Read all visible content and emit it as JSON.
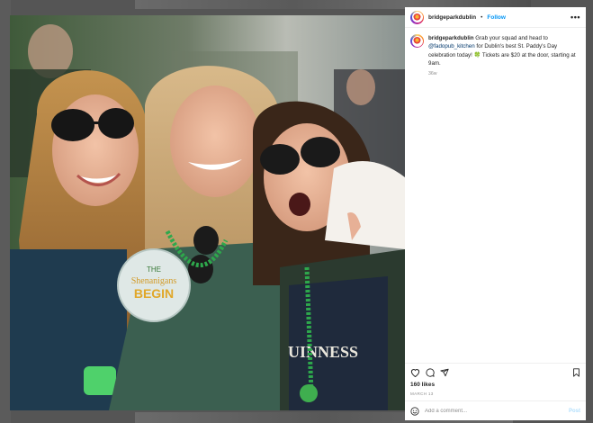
{
  "post": {
    "username": "bridgeparkdublin",
    "separator": "•",
    "follow_label": "Follow",
    "more_label": "•••",
    "caption_username": "bridgeparkdublin",
    "caption_text_1": " Grab your squad and head to ",
    "caption_mention": "@fadopub_kitchen",
    "caption_text_2": " for Dublin's best St. Paddy's Day celebration today! ",
    "caption_emoji": "🍀",
    "caption_text_3": " Tickets are $20 at the door, starting at 9am.",
    "time_ago": "36w",
    "likes": "160 likes",
    "date": "MARCH 13",
    "comment_placeholder": "Add a comment...",
    "post_label": "Post"
  },
  "photo": {
    "button_text_1": "THE",
    "button_text_2": "Shenanigans",
    "button_text_3": "BEGIN",
    "shirt_text": "UINNESS"
  },
  "icons": {
    "heart": "heart-icon",
    "comment": "comment-icon",
    "share": "share-icon",
    "save": "bookmark-icon",
    "emoji": "emoji-icon"
  },
  "colors": {
    "accent": "#0095f6",
    "post_disabled": "#b2dffc",
    "mention": "#00376b"
  }
}
